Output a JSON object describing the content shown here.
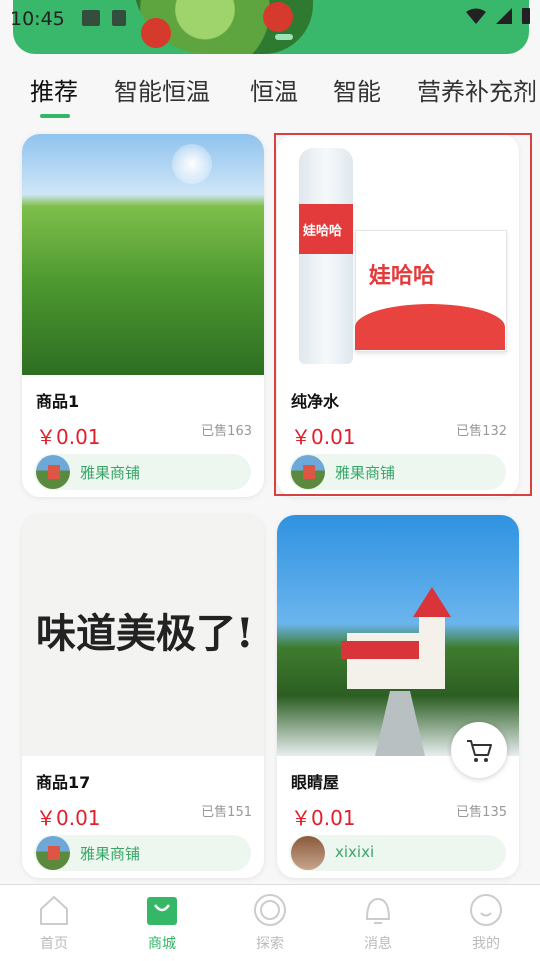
{
  "status_bar": {
    "time": "10:45"
  },
  "tabs": [
    {
      "label": "推荐",
      "active": true
    },
    {
      "label": "智能恒温",
      "active": false
    },
    {
      "label": "恒温",
      "active": false
    },
    {
      "label": "智能",
      "active": false
    },
    {
      "label": "营养补充剂",
      "active": false
    }
  ],
  "products": [
    {
      "name": "商品1",
      "price": "￥0.01",
      "sold": "已售163",
      "shop": "雅果商铺",
      "image": "wheat-field"
    },
    {
      "name": "纯净水",
      "price": "￥0.01",
      "sold": "已售132",
      "shop": "雅果商铺",
      "image": "water-bottle-pack",
      "image_text": "娃哈哈"
    },
    {
      "name": "商品17",
      "price": "￥0.01",
      "sold": "已售151",
      "shop": "雅果商铺",
      "image": "calligraphy",
      "image_text": "味道美极了!"
    },
    {
      "name": "眼睛屋",
      "price": "￥0.01",
      "sold": "已售135",
      "shop": "xixixi",
      "image": "house-on-hill"
    }
  ],
  "nav": [
    {
      "label": "首页",
      "icon": "home-icon",
      "active": false
    },
    {
      "label": "商城",
      "icon": "shopping-bag-icon",
      "active": true
    },
    {
      "label": "探索",
      "icon": "explore-icon",
      "active": false
    },
    {
      "label": "消息",
      "icon": "bell-icon",
      "active": false
    },
    {
      "label": "我的",
      "icon": "profile-icon",
      "active": false
    }
  ],
  "colors": {
    "accent": "#35b768",
    "price": "#e0202c",
    "highlight": "#d94141"
  }
}
